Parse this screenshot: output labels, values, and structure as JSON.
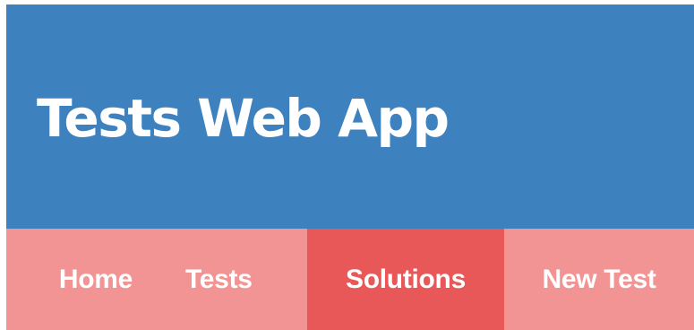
{
  "header": {
    "title": "Tests Web App",
    "background_color": "#3d82bf"
  },
  "nav": {
    "background_color": "#f39494",
    "active_color": "#e85858",
    "items": [
      {
        "label": "Home",
        "active": false
      },
      {
        "label": "Tests",
        "active": false
      },
      {
        "label": "Solutions",
        "active": true
      },
      {
        "label": "New Test",
        "active": false
      }
    ]
  }
}
